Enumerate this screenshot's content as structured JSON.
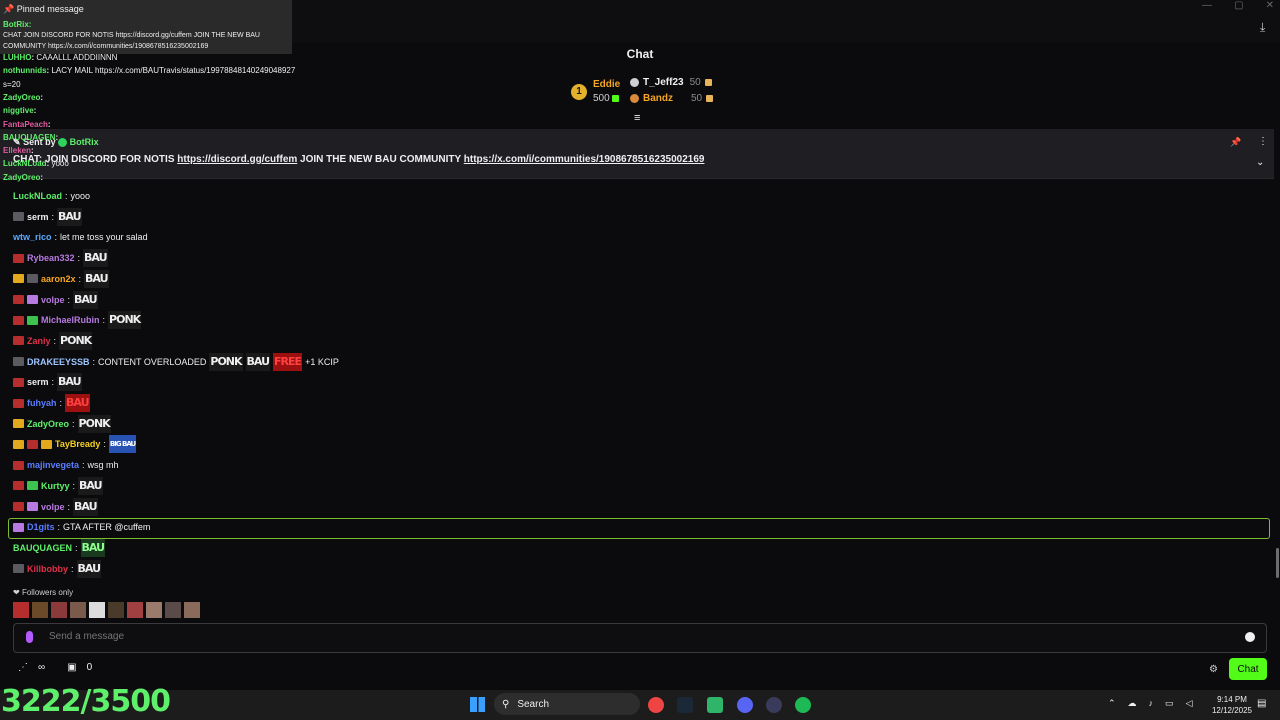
{
  "header": {
    "title": "Chat"
  },
  "leaderboard": {
    "first": {
      "rank": "1",
      "name": "Eddie",
      "amount": "500"
    },
    "second": {
      "name": "T_Jeff23",
      "amount": "50"
    },
    "third": {
      "name": "Bandz",
      "amount": "50"
    }
  },
  "pinned": {
    "sent_by_label": "Sent by",
    "sender": "BotRix",
    "text": "CHAT: JOIN DISCORD FOR NOTIS",
    "link1": "https://discord.gg/cuffem",
    "middle": "JOIN THE NEW BAU COMMUNITY",
    "link2": "https://x.com/i/communities/1908678516235002169"
  },
  "overlay": {
    "pinned_label": "Pinned message",
    "pinned_sender": "BotRix:",
    "pinned_line1": "CHAT JOIN DISCORD FOR NOTIS https://discord.gg/cuffem JOIN THE NEW BAU",
    "pinned_line2": "COMMUNITY https://x.com/i/communities/1908678516235002169",
    "rows": [
      {
        "user": "LUHHO",
        "msg": "CAAALLL ADDDIINNN",
        "color": "#5ef06a"
      },
      {
        "user": "nothunnids",
        "msg": "LACY MAIL https://x.com/BAUTravis/status/19978848140249048927",
        "color": "#5ef06a"
      },
      {
        "user": "",
        "msg": "s=20",
        "color": "#efeff1"
      },
      {
        "user": "ZadyOreo",
        "msg": "",
        "color": "#5ef06a"
      },
      {
        "user": "niggtive",
        "msg": "",
        "color": "#5ef06a"
      },
      {
        "user": "FantaPeach",
        "msg": "",
        "color": "#e05ba0"
      },
      {
        "user": "BAUQUAGEN",
        "msg": "",
        "color": "#5ef06a"
      },
      {
        "user": "Elleken",
        "msg": "",
        "color": "#e05ba0"
      },
      {
        "user": "LuckNLoad",
        "msg": "yooo",
        "color": "#5ef06a"
      },
      {
        "user": "ZadyOreo",
        "msg": "",
        "color": "#5ef06a"
      }
    ]
  },
  "chat": [
    {
      "user": "LuckNLoad",
      "sep": ":",
      "msg": "yooo",
      "color": "#5ef06a",
      "badges": [],
      "emotes": []
    },
    {
      "user": "serm",
      "sep": ":",
      "msg": "",
      "color": "#efeff1",
      "badges": [
        "gray"
      ],
      "emotes": [
        "BAU"
      ]
    },
    {
      "user": "wtw_rico",
      "sep": ":",
      "msg": "let me toss your salad",
      "color": "#5aa9ff",
      "badges": [],
      "emotes": []
    },
    {
      "user": "Rybean332",
      "sep": ":",
      "msg": "",
      "color": "#b77ae0",
      "badges": [
        "red"
      ],
      "emotes": [
        "BAU"
      ]
    },
    {
      "user": "aaron2x",
      "sep": ":",
      "msg": "",
      "color": "#f5a623",
      "badges": [
        "gold",
        "gray"
      ],
      "emotes": [
        "BAU"
      ]
    },
    {
      "user": "volpe",
      "sep": ":",
      "msg": "",
      "color": "#b77ae0",
      "badges": [
        "red",
        "purple"
      ],
      "emotes": [
        "BAU"
      ]
    },
    {
      "user": "MichaelRubin",
      "sep": ":",
      "msg": "",
      "color": "#b77ae0",
      "badges": [
        "red",
        "green"
      ],
      "emotes": [
        "PONK"
      ]
    },
    {
      "user": "Zaniy",
      "sep": ":",
      "msg": "",
      "color": "#e0304a",
      "badges": [
        "red"
      ],
      "emotes": [
        "PONK"
      ]
    },
    {
      "user": "DRAKEEYSSB",
      "sep": ":",
      "msg": "CONTENT OVERLOADED",
      "color": "#9ec6ff",
      "badges": [
        "gray"
      ],
      "emotes": [
        "PONK",
        "BAU",
        "FREE"
      ],
      "suffix": "+1 KCIP"
    },
    {
      "user": "serm",
      "sep": ":",
      "msg": "",
      "color": "#efeff1",
      "badges": [
        "red"
      ],
      "emotes": [
        "BAU"
      ]
    },
    {
      "user": "fuhyah",
      "sep": ":",
      "msg": "",
      "color": "#5a7dff",
      "badges": [
        "red"
      ],
      "emotes": [
        "BAU"
      ]
    },
    {
      "user": "ZadyOreo",
      "sep": ":",
      "msg": "",
      "color": "#5ef06a",
      "badges": [
        "gold"
      ],
      "emotes": [
        "PONK"
      ]
    },
    {
      "user": "TayBready",
      "sep": ":",
      "msg": "",
      "color": "#f5d020",
      "badges": [
        "gold",
        "red",
        "gold"
      ],
      "emotes": [
        "BIG BAU"
      ]
    },
    {
      "user": "majinvegeta",
      "sep": ":",
      "msg": "wsg mh",
      "color": "#5a7dff",
      "badges": [
        "red"
      ],
      "emotes": []
    },
    {
      "user": "Kurtyy",
      "sep": ":",
      "msg": "",
      "color": "#5ef06a",
      "badges": [
        "red",
        "green"
      ],
      "emotes": [
        "BAU"
      ]
    },
    {
      "user": "volpe",
      "sep": ":",
      "msg": "",
      "color": "#b77ae0",
      "badges": [
        "red",
        "purple"
      ],
      "emotes": [
        "BAU"
      ]
    },
    {
      "user": "D1gits",
      "sep": ":",
      "msg": "GTA AFTER @cuffem",
      "color": "#5a7dff",
      "badges": [
        "purple"
      ],
      "emotes": []
    },
    {
      "user": "BAUQUAGEN",
      "sep": ":",
      "msg": "",
      "color": "#5ef06a",
      "badges": [],
      "emotes": [
        "BAU"
      ]
    },
    {
      "user": "Killbobby",
      "sep": ":",
      "msg": "",
      "color": "#e0304a",
      "badges": [
        "gray"
      ],
      "emotes": [
        "BAU"
      ]
    }
  ],
  "footer": {
    "followers_only": "Followers only",
    "placeholder": "Send a message",
    "chat_button": "Chat",
    "bottom_count": "0",
    "counter": "3222/3500"
  },
  "taskbar": {
    "search_label": "Search",
    "time": "9:14 PM",
    "date": "12/12/2025"
  },
  "colors": {
    "accent": "#53fc18",
    "background": "#0b0b0d",
    "highlight_border": "#7bbd2e"
  }
}
